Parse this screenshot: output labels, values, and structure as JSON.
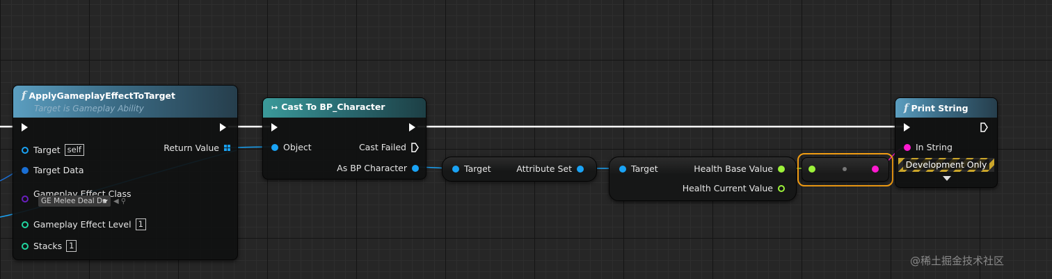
{
  "nodes": {
    "apply_effect": {
      "title": "ApplyGameplayEffectToTarget",
      "subtitle": "Target is Gameplay Ability",
      "pins": {
        "target": "Target",
        "target_default": "self",
        "return_value": "Return Value",
        "target_data": "Target Data",
        "effect_class": "Gameplay Effect Class",
        "effect_class_value": "GE Melee Deal Da",
        "effect_level": "Gameplay Effect Level",
        "effect_level_value": "1",
        "stacks": "Stacks",
        "stacks_value": "1"
      }
    },
    "cast": {
      "title": "Cast To BP_Character",
      "pins": {
        "object": "Object",
        "cast_failed": "Cast Failed",
        "as_bp_character": "As BP Character"
      }
    },
    "attr_getter": {
      "pins": {
        "target": "Target",
        "attribute_set": "Attribute Set"
      }
    },
    "health_getter": {
      "pins": {
        "target": "Target",
        "health_base": "Health Base Value",
        "health_current": "Health Current Value"
      }
    },
    "print_string": {
      "title": "Print String",
      "pins": {
        "in_string": "In String",
        "dev_only": "Development Only"
      }
    }
  },
  "icons": {
    "function": "f",
    "cast": "↦"
  },
  "colors": {
    "exec": "#ffffff",
    "object": "#1aa3f5",
    "struct": "#1a6fd4",
    "class": "#6a1fbf",
    "int": "#20d6a0",
    "float": "#9df23a",
    "string": "#ff1ad0",
    "selection": "#f29d13"
  },
  "watermark": "@稀土掘金技术社区"
}
